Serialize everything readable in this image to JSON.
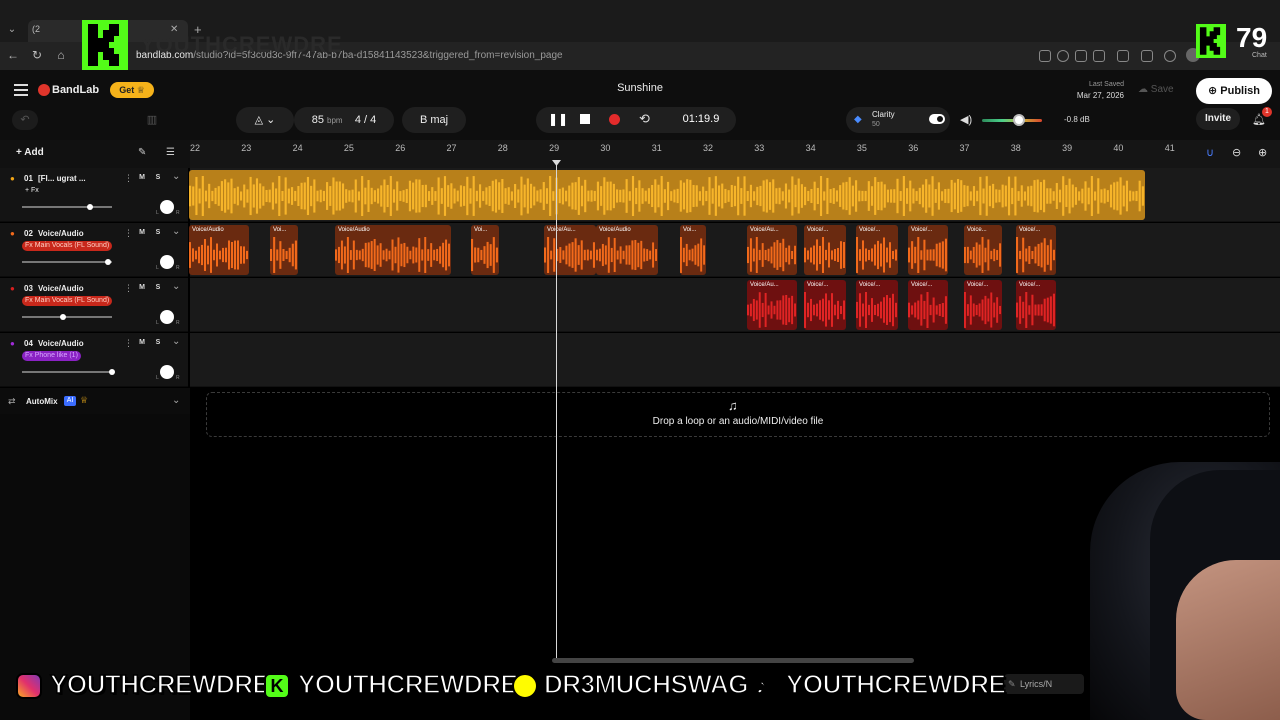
{
  "browser": {
    "url_domain": "bandlab.com",
    "url_path": "/studio?id=5f3c0d3c-9ff7-47ab-b7ba-d15841143523&triggered_from=revision_page",
    "tab_label": "(2"
  },
  "header": {
    "brand": "BandLab",
    "get_label": "Get",
    "project_title": "Sunshine",
    "last_saved_label": "Last Saved",
    "last_saved_date": "Mar 27, 2026",
    "save_label": "Save",
    "publish_label": "Publish",
    "invite_label": "Invite",
    "notification_count": "1"
  },
  "transport": {
    "bpm": "85",
    "bpm_unit": "bpm",
    "time_sig_num": "4",
    "time_sig_sep": "/",
    "time_sig_den": "4",
    "key": "B maj",
    "time": "01:19.9",
    "clarity_label": "Clarity",
    "clarity_value": "50",
    "volume_db": "-0.8 dB",
    "volume_level": 0.62
  },
  "toolbar": {
    "add_label": "Add"
  },
  "ruler": {
    "bars": [
      "22",
      "23",
      "24",
      "25",
      "26",
      "27",
      "28",
      "29",
      "30",
      "31",
      "32",
      "33",
      "34",
      "35",
      "36",
      "37",
      "38",
      "39",
      "40",
      "41"
    ]
  },
  "tracks": [
    {
      "num": "01",
      "name": "[Fl... ugrat ...",
      "fx": "+ Fx",
      "volume": 0.75,
      "color": "#f2a516"
    },
    {
      "num": "02",
      "name": "Voice/Audio",
      "fx": "Fx Main Vocals (FL Sound)",
      "volume": 0.95,
      "color": "#f26a1b"
    },
    {
      "num": "03",
      "name": "Voice/Audio",
      "fx": "Fx Main Vocals (FL Sound)",
      "volume": 0.45,
      "color": "#d81f1f"
    },
    {
      "num": "04",
      "name": "Voice/Audio",
      "fx": "Fx Phone like (1)",
      "volume": 1.0,
      "color": "#a02bd8"
    }
  ],
  "track_controls": {
    "mute": "M",
    "solo": "S"
  },
  "clips": {
    "track2": [
      "Voice/Audio",
      "Voi...",
      "Voice/Audio",
      "Voi...",
      "Voice/Au...",
      "Voice/Audio",
      "Voi...",
      "Voice/Au...",
      "Voice/...",
      "Voice/...",
      "Voice/...",
      "Voice...",
      "Voice/..."
    ],
    "track3": [
      "Voice/Au...",
      "Voice/...",
      "Voice/...",
      "Voice/...",
      "Voice/...",
      "Voice/..."
    ]
  },
  "automix": {
    "label": "AutoMix",
    "ai_badge": "AI"
  },
  "dropzone": {
    "text": "Drop a loop or an audio/MIDI/video file"
  },
  "lyrics_label": "Lyrics/N",
  "stream_overlay": {
    "handle1": "YOUTHCREWDRE",
    "handle2": "YOUTHCREWDRE",
    "handle3": "DR3MUCHSWAG",
    "handle4": "YOUTHCREWDRE",
    "corner_count": "79",
    "chat_label": "Chat",
    "watermark": "YOUTHCREWDRE"
  }
}
